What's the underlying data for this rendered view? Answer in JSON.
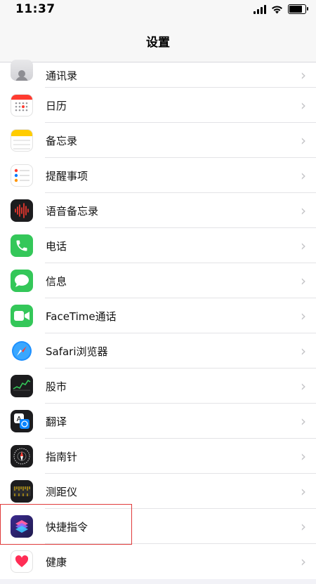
{
  "status": {
    "time": "11:37"
  },
  "nav": {
    "title": "设置"
  },
  "items": [
    {
      "label": "通讯录",
      "icon": "contacts-icon"
    },
    {
      "label": "日历",
      "icon": "calendar-icon"
    },
    {
      "label": "备忘录",
      "icon": "notes-icon"
    },
    {
      "label": "提醒事项",
      "icon": "reminders-icon"
    },
    {
      "label": "语音备忘录",
      "icon": "voice-memos-icon"
    },
    {
      "label": "电话",
      "icon": "phone-icon"
    },
    {
      "label": "信息",
      "icon": "messages-icon"
    },
    {
      "label": "FaceTime通话",
      "icon": "facetime-icon"
    },
    {
      "label": "Safari浏览器",
      "icon": "safari-icon"
    },
    {
      "label": "股市",
      "icon": "stocks-icon"
    },
    {
      "label": "翻译",
      "icon": "translate-icon"
    },
    {
      "label": "指南针",
      "icon": "compass-icon"
    },
    {
      "label": "测距仪",
      "icon": "measure-icon"
    },
    {
      "label": "快捷指令",
      "icon": "shortcuts-icon"
    },
    {
      "label": "健康",
      "icon": "health-icon"
    }
  ],
  "colors": {
    "highlight": "#e03a3a",
    "phone": "#34c759",
    "messages": "#34c759",
    "facetime": "#34c759",
    "notes": "#ffcc00"
  }
}
